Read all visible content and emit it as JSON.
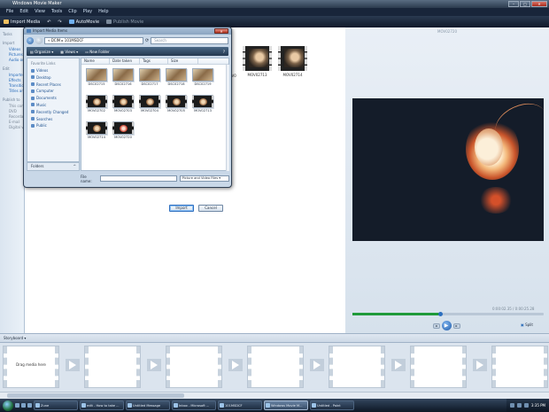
{
  "window": {
    "title": "Windows Movie Maker",
    "controls": [
      "–",
      "□",
      "✕"
    ]
  },
  "menu": [
    "File",
    "Edit",
    "View",
    "Tools",
    "Clip",
    "Play",
    "Help"
  ],
  "toolbar": {
    "import": "Import Media",
    "automovie": "AutoMovie",
    "publish": "Publish Movie"
  },
  "tasks": {
    "header": "Tasks",
    "sections": [
      {
        "title": "Import",
        "items": [
          "Videos",
          "Pictures",
          "Audio or Music"
        ]
      },
      {
        "title": "Edit",
        "items": [
          "Imported media",
          "Effects",
          "Transitions",
          "Titles and credits"
        ]
      },
      {
        "title": "Publish to",
        "items": [
          "This computer",
          "DVD",
          "Recordable CD",
          "E-mail",
          "Digital video camera"
        ]
      }
    ]
  },
  "collection": {
    "clips": [
      {
        "label": "MOV02062",
        "partial": true
      },
      {
        "label": "MOV02713"
      },
      {
        "label": "MOV02714"
      }
    ]
  },
  "preview": {
    "title": "MOV02720",
    "timecode": "0:00:02.35 / 0:00:25.28",
    "progress": 0.46,
    "split_label": "Split"
  },
  "storyboard": {
    "label": "Storyboard",
    "drag_hint": "Drag media here"
  },
  "dialog": {
    "title": "Import Media Items",
    "close": "✕",
    "path": "« DCIM ▸ 101MSDCF",
    "search_placeholder": "Search",
    "toolbar": {
      "organize": "Organize",
      "views": "Views",
      "new_folder": "New Folder"
    },
    "favorites_header": "Favorite Links",
    "favorites": [
      "Videos",
      "Desktop",
      "Recent Places",
      "Computer",
      "Documents",
      "Music",
      "Recently Changed",
      "Searches",
      "Public"
    ],
    "folders_label": "Folders",
    "columns": [
      "Name",
      "Date taken",
      "Tags",
      "Size"
    ],
    "files": [
      {
        "name": "DSC02715",
        "kind": "img"
      },
      {
        "name": "DSC02716",
        "kind": "img"
      },
      {
        "name": "DSC02717",
        "kind": "img"
      },
      {
        "name": "DSC02718",
        "kind": "img"
      },
      {
        "name": "DSC02719",
        "kind": "img"
      },
      {
        "name": "MOV02702",
        "kind": "vid"
      },
      {
        "name": "MOV02703",
        "kind": "vid"
      },
      {
        "name": "MOV02704",
        "kind": "vid"
      },
      {
        "name": "MOV02705",
        "kind": "vid"
      },
      {
        "name": "MOV02713",
        "kind": "vid"
      },
      {
        "name": "MOV02714",
        "kind": "vid"
      },
      {
        "name": "MOV02720",
        "kind": "red"
      }
    ],
    "filename_label": "File name:",
    "filename_value": "",
    "filetype": "Picture and Video Files",
    "import_button": "Import",
    "cancel_button": "Cancel"
  },
  "taskbar": {
    "tasks": [
      "Zune",
      "edit - How to take ...",
      "Untitled Message",
      "Inbox - Microsoft ...",
      "101MSDCF",
      "Windows Movie M...",
      "Untitled - Paint"
    ],
    "active_index": 5,
    "clock": "3:35 PM"
  }
}
